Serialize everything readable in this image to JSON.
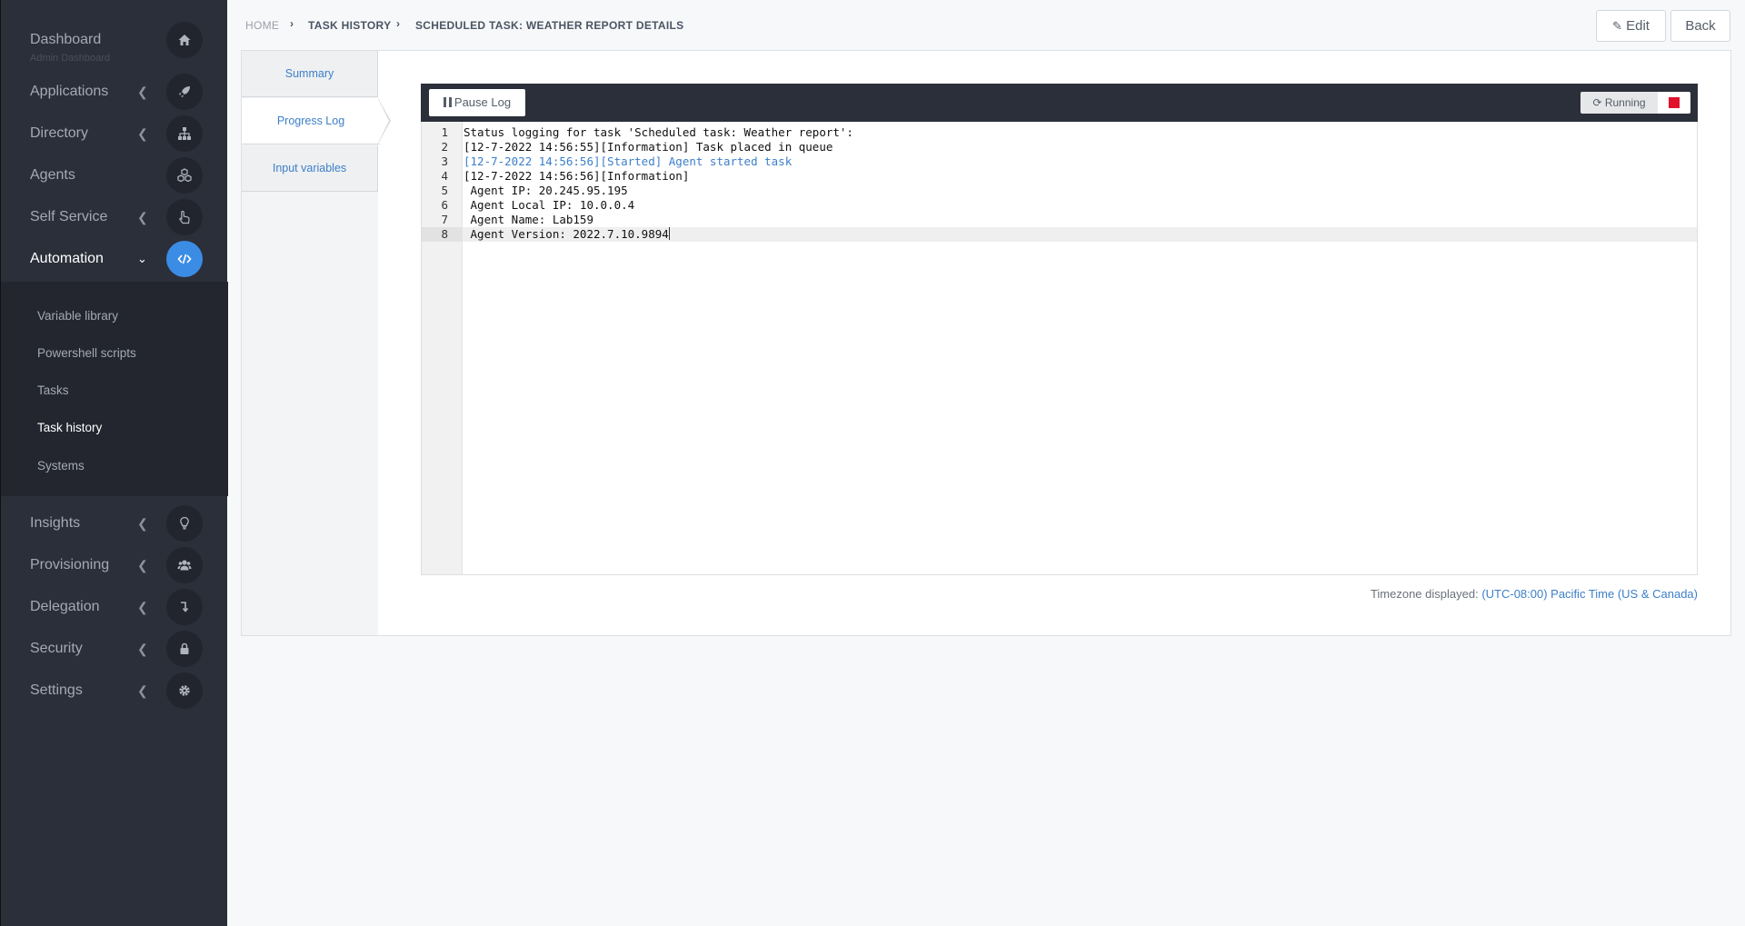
{
  "sidebar": {
    "items": [
      {
        "label": "Dashboard",
        "sub": "Admin Dashboard",
        "icon": "home-icon"
      },
      {
        "label": "Applications",
        "icon": "rocket-icon"
      },
      {
        "label": "Directory",
        "icon": "sitemap-icon"
      },
      {
        "label": "Agents",
        "icon": "cubes-icon"
      },
      {
        "label": "Self Service",
        "icon": "hand-pointer-icon"
      },
      {
        "label": "Automation",
        "icon": "code-icon"
      },
      {
        "label": "Insights",
        "icon": "lightbulb-icon"
      },
      {
        "label": "Provisioning",
        "icon": "users-icon"
      },
      {
        "label": "Delegation",
        "icon": "level-down-icon"
      },
      {
        "label": "Security",
        "icon": "lock-icon"
      },
      {
        "label": "Settings",
        "icon": "gear-icon"
      }
    ],
    "automation_submenu": [
      {
        "label": "Variable library"
      },
      {
        "label": "Powershell scripts"
      },
      {
        "label": "Tasks"
      },
      {
        "label": "Task history"
      },
      {
        "label": "Systems"
      }
    ]
  },
  "breadcrumb": {
    "home": "HOME",
    "section": "TASK HISTORY",
    "current": "SCHEDULED TASK: WEATHER REPORT DETAILS"
  },
  "header": {
    "edit_label": "Edit",
    "back_label": "Back"
  },
  "tabs": [
    {
      "label": "Summary"
    },
    {
      "label": "Progress Log"
    },
    {
      "label": "Input variables"
    }
  ],
  "log": {
    "pause_label": "Pause Log",
    "status_label": "Running",
    "lines": [
      {
        "num": "1",
        "text": "Status logging for task 'Scheduled task: Weather report':"
      },
      {
        "num": "2",
        "text": "[12-7-2022 14:56:55][Information] Task placed in queue"
      },
      {
        "num": "3",
        "text": "[12-7-2022 14:56:56][Started] Agent started task"
      },
      {
        "num": "4",
        "text": "[12-7-2022 14:56:56][Information]"
      },
      {
        "num": "5",
        "text": " Agent IP: 20.245.95.195"
      },
      {
        "num": "6",
        "text": " Agent Local IP: 10.0.0.4"
      },
      {
        "num": "7",
        "text": " Agent Name: Lab159"
      },
      {
        "num": "8",
        "text": " Agent Version: 2022.7.10.9894"
      }
    ]
  },
  "timezone": {
    "label": "Timezone displayed:",
    "value": "(UTC-08:00) Pacific Time (US & Canada)"
  },
  "colors": {
    "sidebar_bg": "#2b2f3a",
    "accent": "#3a8ce4",
    "link": "#3c7fc8",
    "stop": "#e0132b"
  }
}
